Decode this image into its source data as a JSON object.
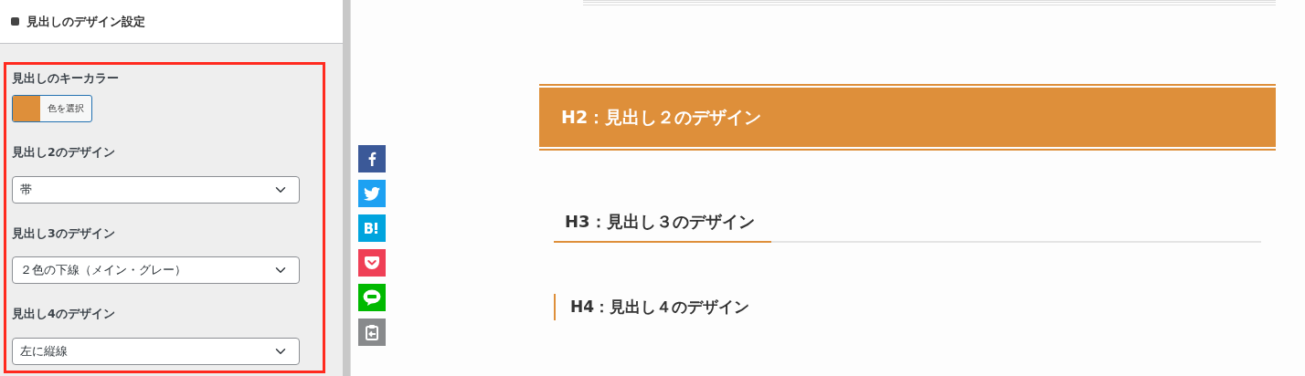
{
  "sidebar": {
    "title": "見出しのデザイン設定",
    "key_color": {
      "label": "見出しのキーカラー",
      "button_label": "色を選択",
      "color": "#de8f3a"
    },
    "selects": [
      {
        "label": "見出し2のデザイン",
        "value": "帯"
      },
      {
        "label": "見出し3のデザイン",
        "value": "２色の下線（メイン・グレー）"
      },
      {
        "label": "見出し4のデザイン",
        "value": "左に縦線"
      }
    ]
  },
  "share_buttons": [
    {
      "kind": "facebook",
      "color": "#3b5998"
    },
    {
      "kind": "twitter",
      "color": "#1da1f2"
    },
    {
      "kind": "hatena",
      "color": "#00a4de"
    },
    {
      "kind": "pocket",
      "color": "#ef3f56"
    },
    {
      "kind": "line",
      "color": "#00b900"
    },
    {
      "kind": "copy",
      "color": "#888a8c"
    }
  ],
  "preview": [
    {
      "kind": "band",
      "text": "H2：見出し２のデザイン"
    },
    {
      "kind": "underline",
      "text": "H3：見出し３のデザイン"
    },
    {
      "kind": "leftline",
      "text": "H4：見出し４のデザイン"
    }
  ]
}
